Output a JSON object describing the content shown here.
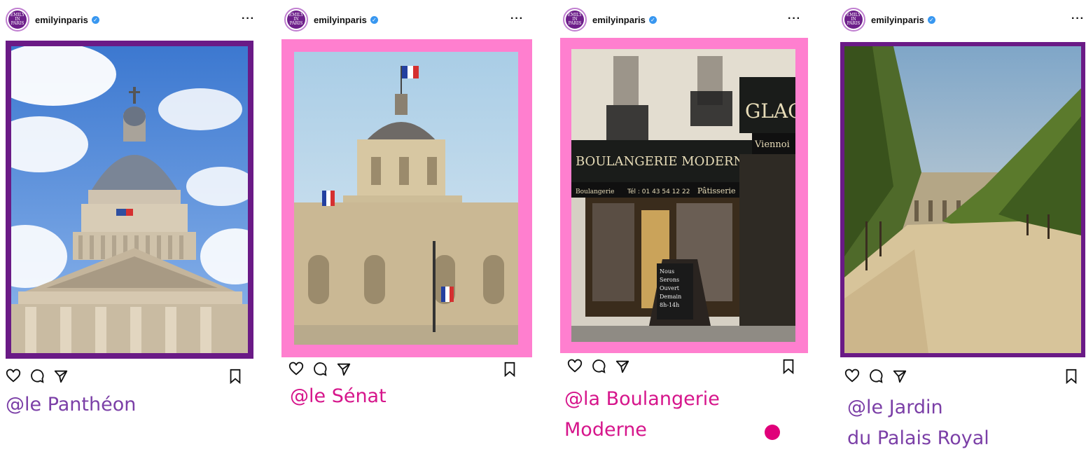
{
  "posts": [
    {
      "username": "emilyinparis",
      "more": "···",
      "avatar_text": [
        "EMILY",
        "IN",
        "PARIS"
      ],
      "caption_lines": [
        "@le Panthéon"
      ],
      "caption_color": "#7b3fa7",
      "frame_color": "#6a1a86",
      "image": "pantheon-photo"
    },
    {
      "username": "emilyinparis",
      "more": "···",
      "avatar_text": [
        "EMILY",
        "IN",
        "PARIS"
      ],
      "caption_lines": [
        "@le Sénat"
      ],
      "caption_color": "#d6158b",
      "frame_color": "#ff7fcf",
      "image": "senat-photo"
    },
    {
      "username": "emilyinparis",
      "more": "···",
      "avatar_text": [
        "EMILY",
        "IN",
        "PARIS"
      ],
      "caption_lines": [
        "@la Boulangerie",
        "Moderne"
      ],
      "caption_color": "#d6158b",
      "frame_color": "#ff7fcf",
      "image": "boulangerie-photo",
      "shop_sign": "BOULANGERIE MODERNE",
      "shop_sign_side": "GLAC",
      "shop_sub": "Pâtisserie",
      "shop_left": "Boulangerie",
      "shop_phone": "Tél : 01 43 54 12 22",
      "shop_side2": "Viennoi",
      "chalk_lines": [
        "Nous",
        "Serons",
        "Ouvert",
        "Demain",
        "8h-14h"
      ]
    },
    {
      "username": "emilyinparis",
      "more": "···",
      "avatar_text": [
        "EMILY",
        "IN",
        "PARIS"
      ],
      "caption_lines": [
        "@le Jardin",
        "du Palais Royal"
      ],
      "caption_color": "#7b3fa7",
      "frame_color": "#6a1a86",
      "image": "jardin-photo"
    }
  ],
  "colors": {
    "verified": "#3897f0",
    "dot": "#e0007a"
  }
}
